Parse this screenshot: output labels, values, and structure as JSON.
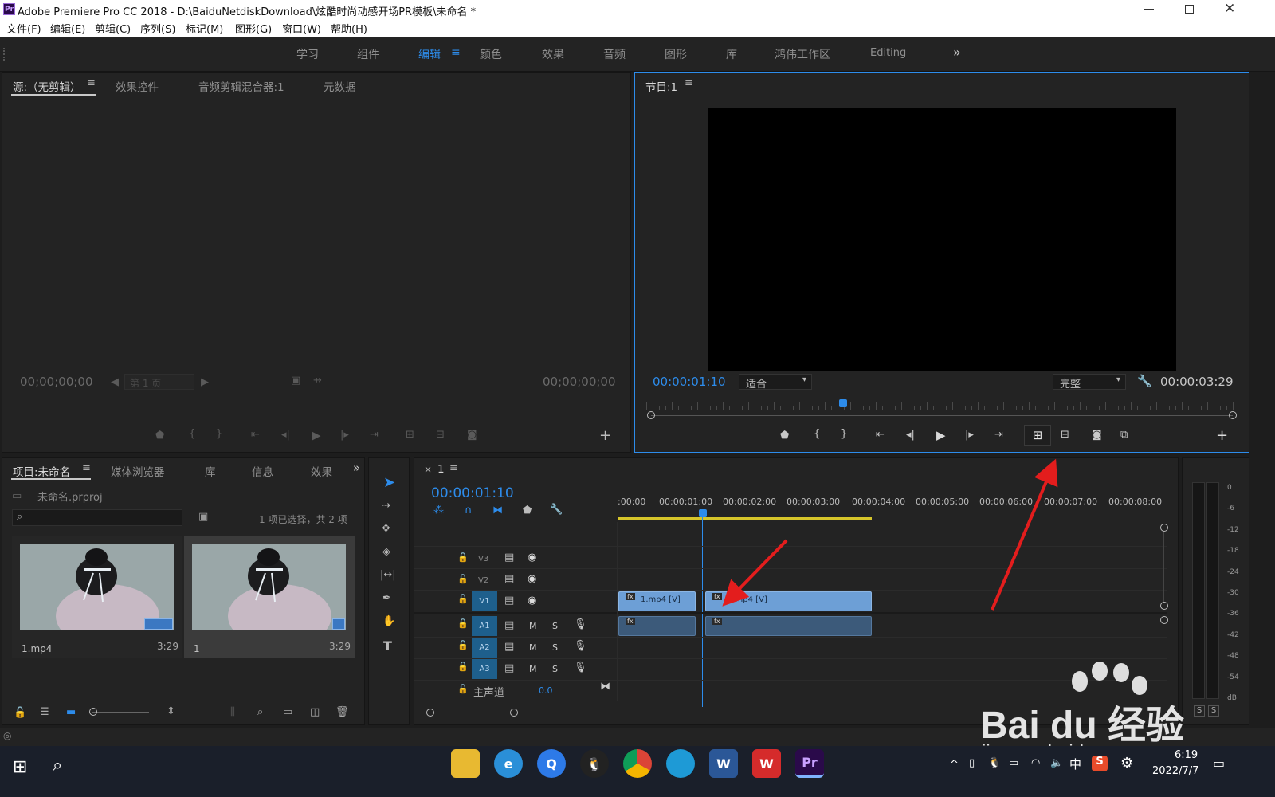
{
  "titlebar": {
    "title": "Adobe Premiere Pro CC 2018 - D:\\BaiduNetdiskDownload\\炫酷时尚动感开场PR模板\\未命名 *",
    "app_badge": "Pr"
  },
  "menu": [
    "文件(F)",
    "编辑(E)",
    "剪辑(C)",
    "序列(S)",
    "标记(M)",
    "图形(G)",
    "窗口(W)",
    "帮助(H)"
  ],
  "workspaces": [
    "学习",
    "组件",
    "编辑",
    "颜色",
    "效果",
    "音频",
    "图形",
    "库",
    "鸿伟工作区",
    "Editing"
  ],
  "source_panel": {
    "tabs": [
      "源:（无剪辑）",
      "效果控件",
      "音频剪辑混合器:1",
      "元数据"
    ],
    "timecode_left": "00;00;00;00",
    "timecode_right": "00;00;00;00",
    "page": "第 1 页"
  },
  "program_panel": {
    "tab": "节目:1",
    "timecode": "00:00:01:10",
    "fit": "适合",
    "quality": "完整",
    "duration": "00:00:03:29"
  },
  "project_panel": {
    "tabs": [
      "项目:未命名",
      "媒体浏览器",
      "库",
      "信息",
      "效果"
    ],
    "project_file": "未命名.prproj",
    "selection_info": "1 项已选择，共 2 项",
    "items": [
      {
        "name": "1.mp4",
        "duration": "3:29"
      },
      {
        "name": "1",
        "duration": "3:29"
      }
    ]
  },
  "timeline": {
    "tab": "1",
    "close": "×",
    "timecode": "00:00:01:10",
    "ruler": [
      ":00:00",
      "00:00:01:00",
      "00:00:02:00",
      "00:00:03:00",
      "00:00:04:00",
      "00:00:05:00",
      "00:00:06:00",
      "00:00:07:00",
      "00:00:08:00"
    ],
    "video_tracks": [
      "V3",
      "V2",
      "V1"
    ],
    "audio_tracks": [
      "A1",
      "A2",
      "A3"
    ],
    "master_label": "主声道",
    "master_value": "0.0",
    "clip1_label": "1.mp4 [V]",
    "clip2_label": "1.mp4 [V]",
    "m_label": "M",
    "s_label": "S",
    "fx_label": "fx"
  },
  "meter": {
    "scale": [
      "0",
      "-6",
      "-12",
      "-18",
      "-24",
      "-30",
      "-36",
      "-42",
      "-48",
      "-54",
      "dB"
    ],
    "solo_labels": [
      "S",
      "S"
    ]
  },
  "taskbar": {
    "time": "6:19",
    "date": "2022/7/7",
    "ime": "中"
  },
  "watermark": {
    "line1": "Bai du 经验",
    "line2": "jingyan.baidu.com"
  },
  "colors": {
    "accent": "#2d8ceb",
    "annotation_arrow": "#e31d1d",
    "track_target": "#1e5f8c",
    "work_area": "#d6c52a"
  }
}
